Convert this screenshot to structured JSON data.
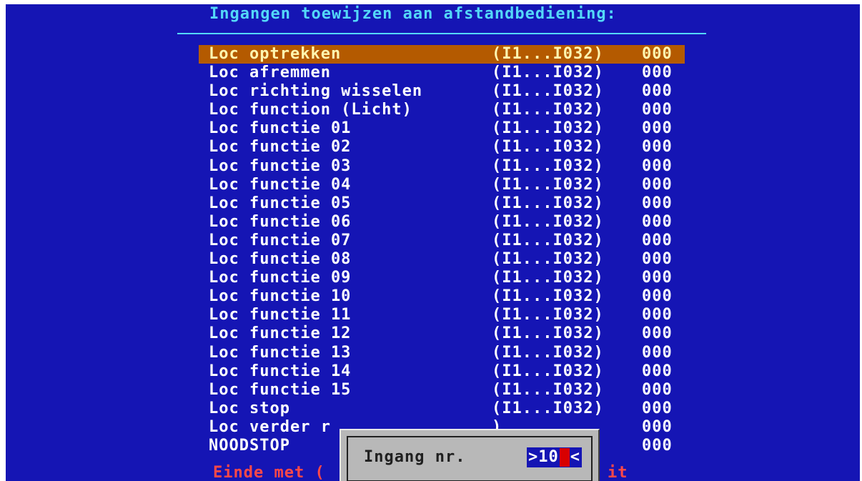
{
  "title": "Ingangen toewijzen aan afstandbediening:",
  "rows": [
    {
      "label": "Loc optrekken",
      "range": "(I1...I032)",
      "value": "000"
    },
    {
      "label": "Loc afremmen",
      "range": "(I1...I032)",
      "value": "000"
    },
    {
      "label": "Loc richting wisselen",
      "range": "(I1...I032)",
      "value": "000"
    },
    {
      "label": "Loc function (Licht)",
      "range": "(I1...I032)",
      "value": "000"
    },
    {
      "label": "Loc functie 01",
      "range": "(I1...I032)",
      "value": "000"
    },
    {
      "label": "Loc functie 02",
      "range": "(I1...I032)",
      "value": "000"
    },
    {
      "label": "Loc functie 03",
      "range": "(I1...I032)",
      "value": "000"
    },
    {
      "label": "Loc functie 04",
      "range": "(I1...I032)",
      "value": "000"
    },
    {
      "label": "Loc functie 05",
      "range": "(I1...I032)",
      "value": "000"
    },
    {
      "label": "Loc functie 06",
      "range": "(I1...I032)",
      "value": "000"
    },
    {
      "label": "Loc functie 07",
      "range": "(I1...I032)",
      "value": "000"
    },
    {
      "label": "Loc functie 08",
      "range": "(I1...I032)",
      "value": "000"
    },
    {
      "label": "Loc functie 09",
      "range": "(I1...I032)",
      "value": "000"
    },
    {
      "label": "Loc functie 10",
      "range": "(I1...I032)",
      "value": "000"
    },
    {
      "label": "Loc functie 11",
      "range": "(I1...I032)",
      "value": "000"
    },
    {
      "label": "Loc functie 12",
      "range": "(I1...I032)",
      "value": "000"
    },
    {
      "label": "Loc functie 13",
      "range": "(I1...I032)",
      "value": "000"
    },
    {
      "label": "Loc functie 14",
      "range": "(I1...I032)",
      "value": "000"
    },
    {
      "label": "Loc functie 15",
      "range": "(I1...I032)",
      "value": "000"
    },
    {
      "label": "Loc stop",
      "range": "(I1...I032)",
      "value": "000"
    },
    {
      "label": "Loc verder r",
      "range": ")",
      "value": "000"
    },
    {
      "label": "NOODSTOP",
      "range": ")",
      "value": "000"
    }
  ],
  "selected_index": 0,
  "footer": {
    "left": "Einde met (",
    "right": "it"
  },
  "dialog": {
    "label": "Ingang nr.",
    "field_prefix": ">10",
    "field_suffix": "<"
  },
  "colors": {
    "background": "#1515b4",
    "title": "#54d8f8",
    "highlight": "#b45a00",
    "footer": "#ff4848",
    "cursor": "#d80000",
    "dialog": "#b8b8b8"
  }
}
